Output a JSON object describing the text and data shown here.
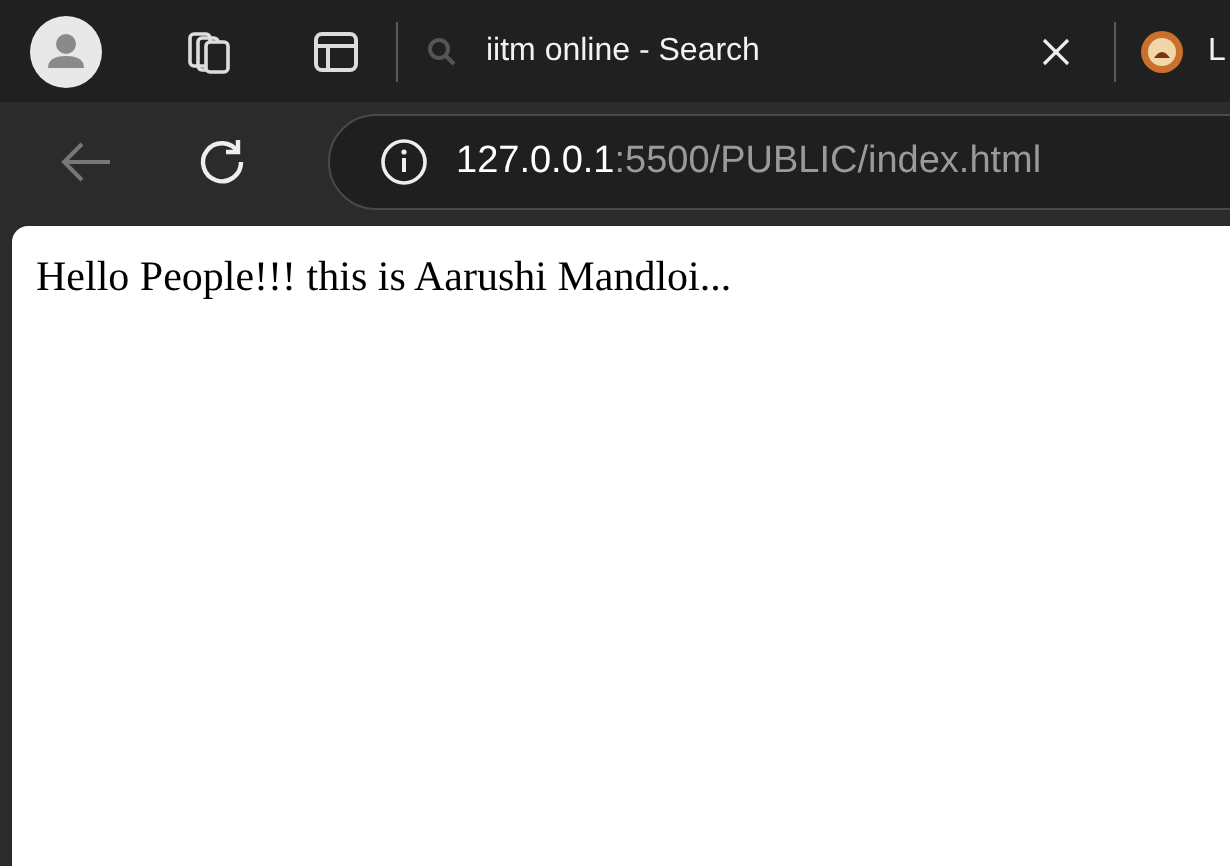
{
  "tabs": [
    {
      "title": "iitm online - Search",
      "kind": "search"
    },
    {
      "title": "L",
      "kind": "site"
    }
  ],
  "toolbar": {
    "back_disabled": true
  },
  "address": {
    "host": "127.0.0.1",
    "path": ":5500/PUBLIC/index.html"
  },
  "page": {
    "text": "Hello People!!! this is Aarushi Mandloi..."
  }
}
